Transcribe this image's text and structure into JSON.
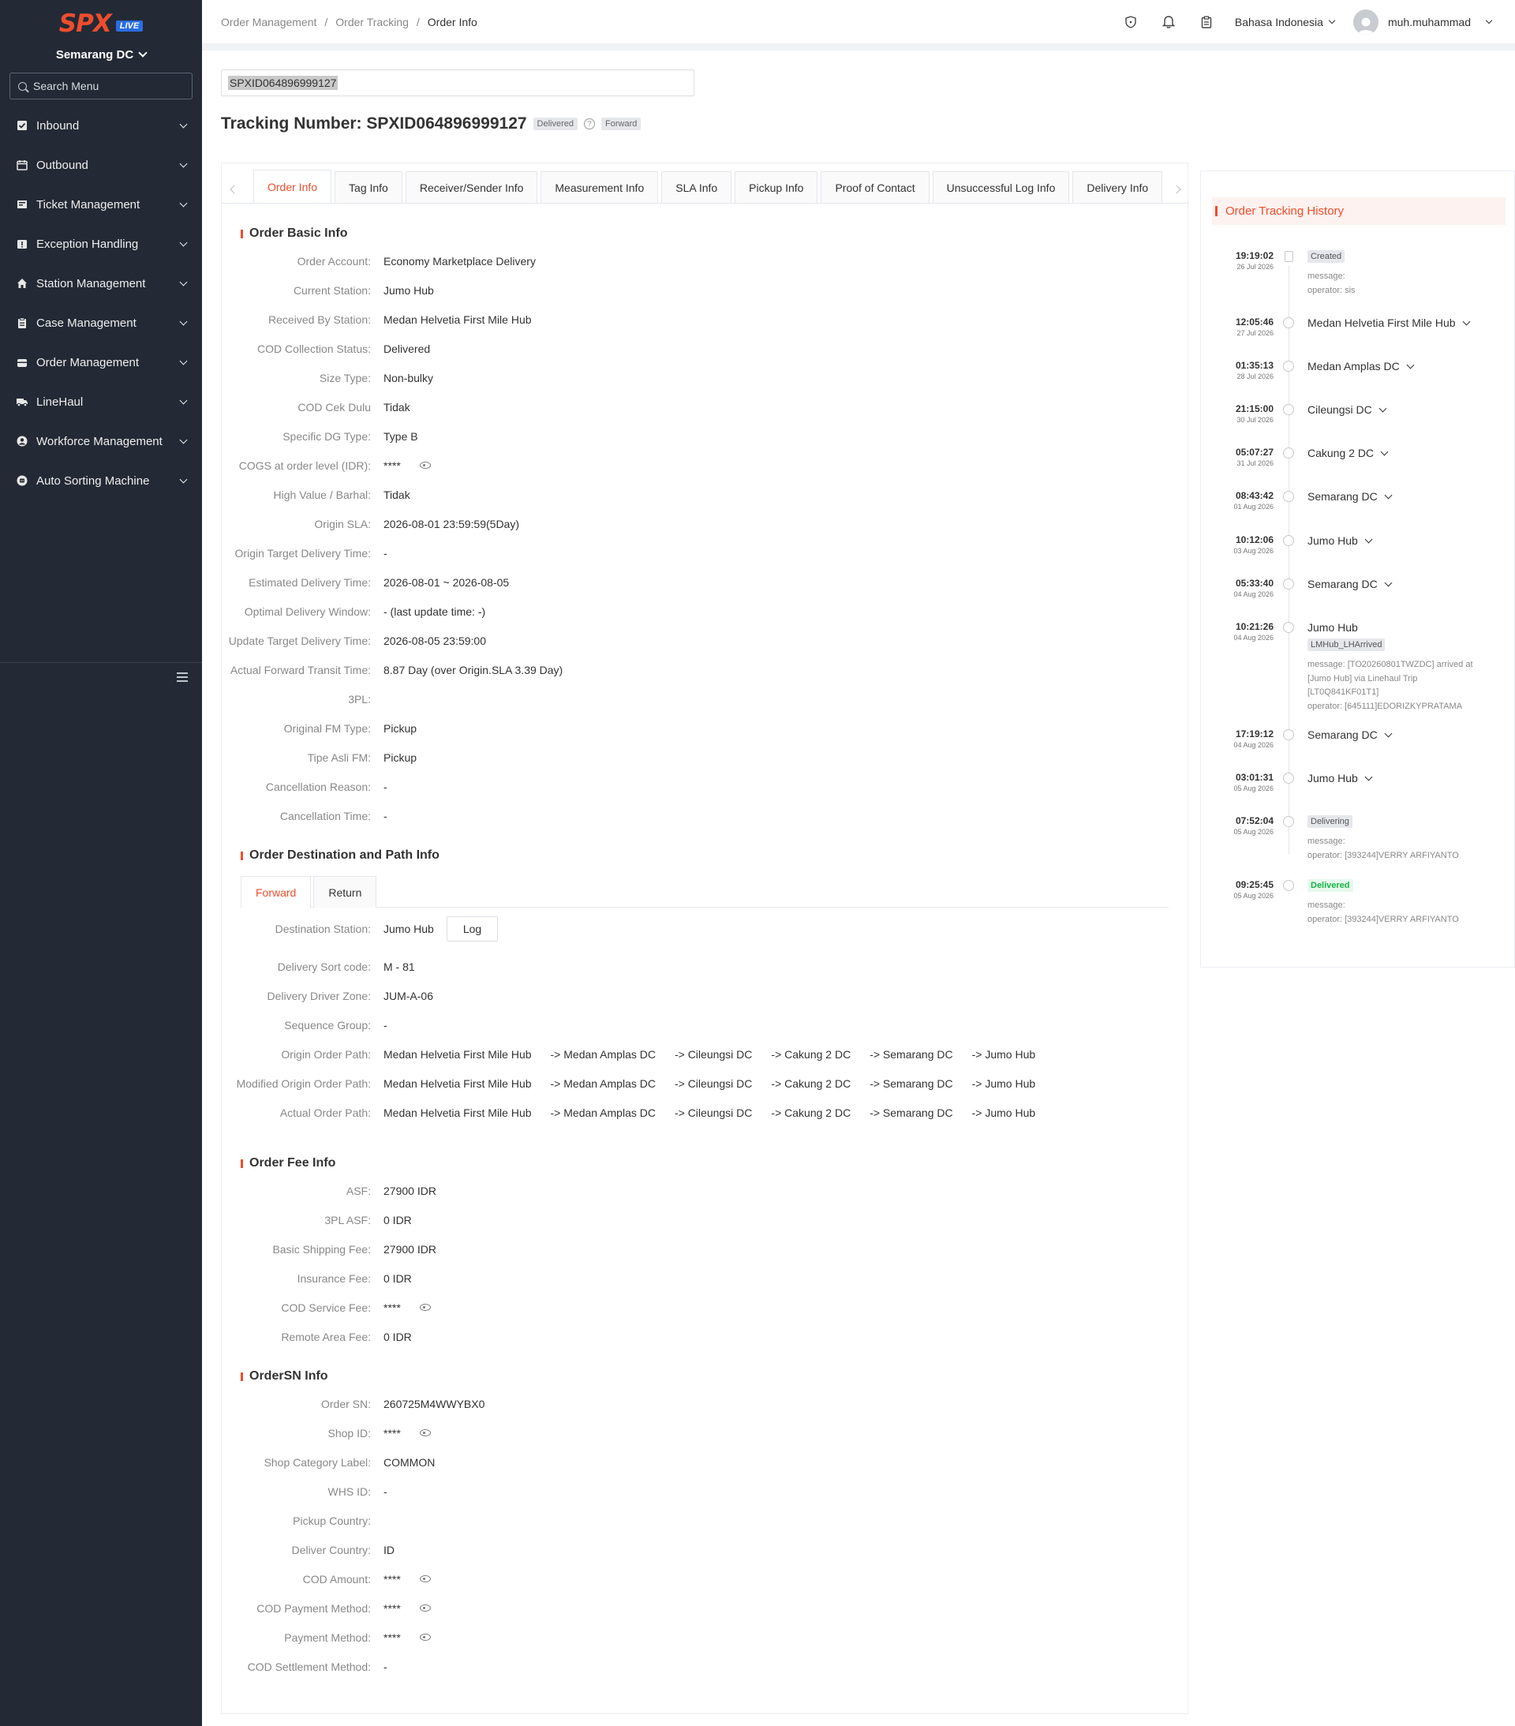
{
  "sidebar": {
    "logo": "SPX",
    "live_badge": "LIVE",
    "station": "Semarang DC",
    "search_placeholder": "Search Menu",
    "items": [
      {
        "label": "Inbound",
        "icon": "inbound-icon"
      },
      {
        "label": "Outbound",
        "icon": "calendar-icon"
      },
      {
        "label": "Ticket Management",
        "icon": "ticket-icon"
      },
      {
        "label": "Exception Handling",
        "icon": "warning-icon"
      },
      {
        "label": "Station Management",
        "icon": "home-icon"
      },
      {
        "label": "Case Management",
        "icon": "clipboard-icon"
      },
      {
        "label": "Order Management",
        "icon": "order-icon"
      },
      {
        "label": "LineHaul",
        "icon": "truck-icon"
      },
      {
        "label": "Workforce Management",
        "icon": "user-circle-icon"
      },
      {
        "label": "Auto Sorting Machine",
        "icon": "robot-icon"
      }
    ]
  },
  "header": {
    "breadcrumb": [
      "Order Management",
      "Order Tracking",
      "Order Info"
    ],
    "language": "Bahasa Indonesia",
    "username": "muh.muhammad"
  },
  "top": {
    "search_value": "SPXID064896999127",
    "title": "Tracking Number: SPXID064896999127",
    "status": "Delivered",
    "direction": "Forward"
  },
  "tabs": [
    "Order Info",
    "Tag Info",
    "Receiver/Sender Info",
    "Measurement Info",
    "SLA Info",
    "Pickup Info",
    "Proof of Contact",
    "Unsuccessful Log Info",
    "Delivery Info"
  ],
  "basic": {
    "title": "Order Basic Info",
    "rows": [
      {
        "label": "Order Account:",
        "value": "Economy Marketplace Delivery"
      },
      {
        "label": "Current Station:",
        "value": "Jumo Hub"
      },
      {
        "label": "Received By Station:",
        "value": "Medan Helvetia First Mile Hub"
      },
      {
        "label": "COD Collection Status:",
        "value": "Delivered"
      },
      {
        "label": "Size Type:",
        "value": "Non-bulky"
      },
      {
        "label": "COD Cek Dulu",
        "value": "Tidak"
      },
      {
        "label": "Specific DG Type:",
        "value": "Type B"
      },
      {
        "label": "COGS at order level (IDR):",
        "value": "****",
        "eye": true
      },
      {
        "label": "High Value / Barhal:",
        "value": "Tidak"
      },
      {
        "label": "Origin SLA:",
        "value": "2026-08-01 23:59:59(5Day)"
      },
      {
        "label": "Origin Target Delivery Time:",
        "value": "-"
      },
      {
        "label": "Estimated Delivery Time:",
        "value": "2026-08-01 ~ 2026-08-05"
      },
      {
        "label": "Optimal Delivery Window:",
        "value": "- (last update time: -)"
      },
      {
        "label": "Update Target Delivery Time:",
        "value": "2026-08-05 23:59:00"
      },
      {
        "label": "Actual Forward Transit Time:",
        "value": "8.87 Day (over Origin.SLA 3.39 Day)"
      },
      {
        "label": "3PL:",
        "value": ""
      },
      {
        "label": "Original FM Type:",
        "value": "Pickup"
      },
      {
        "label": "Tipe Asli FM:",
        "value": "Pickup"
      },
      {
        "label": "Cancellation Reason:",
        "value": "-"
      },
      {
        "label": "Cancellation Time:",
        "value": "-"
      }
    ]
  },
  "dest": {
    "title": "Order Destination and Path Info",
    "sub_tabs": [
      "Forward",
      "Return"
    ],
    "dest_label": "Destination Station:",
    "dest_value": "Jumo Hub",
    "log_button": "Log",
    "rows": [
      {
        "label": "Delivery Sort code:",
        "value": "M - 81"
      },
      {
        "label": "Delivery Driver Zone:",
        "value": "JUM-A-06"
      },
      {
        "label": "Sequence Group:",
        "value": "-"
      }
    ],
    "paths": [
      {
        "label": "Origin Order Path:",
        "nodes": [
          "Medan Helvetia First Mile Hub",
          "-> Medan Amplas DC",
          "-> Cileungsi DC",
          "-> Cakung 2 DC",
          "-> Semarang DC",
          "-> Jumo Hub"
        ]
      },
      {
        "label": "Modified Origin Order Path:",
        "nodes": [
          "Medan Helvetia First Mile Hub",
          "-> Medan Amplas DC",
          "-> Cileungsi DC",
          "-> Cakung 2 DC",
          "-> Semarang DC",
          "-> Jumo Hub"
        ]
      },
      {
        "label": "Actual Order Path:",
        "nodes": [
          "Medan Helvetia First Mile Hub",
          "-> Medan Amplas DC",
          "-> Cileungsi DC",
          "-> Cakung 2 DC",
          "-> Semarang DC",
          "-> Jumo Hub"
        ]
      }
    ]
  },
  "fee": {
    "title": "Order Fee Info",
    "rows": [
      {
        "label": "ASF:",
        "value": "27900 IDR"
      },
      {
        "label": "3PL ASF:",
        "value": "0 IDR"
      },
      {
        "label": "Basic Shipping Fee:",
        "value": "27900 IDR"
      },
      {
        "label": "Insurance Fee:",
        "value": "0 IDR"
      },
      {
        "label": "COD Service Fee:",
        "value": "****",
        "eye": true
      },
      {
        "label": "Remote Area Fee:",
        "value": "0 IDR"
      }
    ]
  },
  "sn": {
    "title": "OrderSN Info",
    "rows": [
      {
        "label": "Order SN:",
        "value": "260725M4WWYBX0"
      },
      {
        "label": "Shop ID:",
        "value": "****",
        "eye": true
      },
      {
        "label": "Shop Category Label:",
        "value": "COMMON"
      },
      {
        "label": "WHS ID:",
        "value": "-"
      },
      {
        "label": "Pickup Country:",
        "value": ""
      },
      {
        "label": "Deliver Country:",
        "value": "ID"
      },
      {
        "label": "COD Amount:",
        "value": "****",
        "eye": true
      },
      {
        "label": "COD Payment Method:",
        "value": "****",
        "eye": true
      },
      {
        "label": "Payment Method:",
        "value": "****",
        "eye": true
      },
      {
        "label": "COD Settlement Method:",
        "value": "-"
      }
    ]
  },
  "history": {
    "title": "Order Tracking History",
    "events": [
      {
        "time": "19:19:02",
        "date": "26 Jul 2026",
        "tag": "Created",
        "msg": [
          "message:",
          "operator: sis"
        ]
      },
      {
        "time": "12:05:46",
        "date": "27 Jul 2026",
        "name": "Medan Helvetia First Mile Hub"
      },
      {
        "time": "01:35:13",
        "date": "28 Jul 2026",
        "name": "Medan Amplas DC"
      },
      {
        "time": "21:15:00",
        "date": "30 Jul 2026",
        "name": "Cileungsi DC"
      },
      {
        "time": "05:07:27",
        "date": "31 Jul 2026",
        "name": "Cakung 2 DC"
      },
      {
        "time": "08:43:42",
        "date": "01 Aug 2026",
        "name": "Semarang DC"
      },
      {
        "time": "10:12:06",
        "date": "03 Aug 2026",
        "name": "Jumo Hub"
      },
      {
        "time": "05:33:40",
        "date": "04 Aug 2026",
        "name": "Semarang DC"
      },
      {
        "time": "10:21:26",
        "date": "04 Aug 2026",
        "name": "Jumo Hub",
        "tag": "LMHub_LHArrived",
        "msg": [
          "message: [TO20260801TWZDC] arrived at",
          "[Jumo Hub] via Linehaul Trip",
          "[LT0Q841KF01T1]",
          "operator: [645111]EDORIZKYPRATAMA"
        ]
      },
      {
        "time": "17:19:12",
        "date": "04 Aug 2026",
        "name": "Semarang DC"
      },
      {
        "time": "03:01:31",
        "date": "05 Aug 2026",
        "name": "Jumo Hub"
      },
      {
        "time": "07:52:04",
        "date": "05 Aug 2026",
        "tag": "Delivering",
        "msg": [
          "message:",
          "operator: [393244]VERRY ARFIYANTO"
        ]
      },
      {
        "time": "09:25:45",
        "date": "05 Aug 2026",
        "tag": "Delivered",
        "tag_color": "green",
        "msg": [
          "message:",
          "operator: [393244]VERRY ARFIYANTO"
        ]
      }
    ]
  },
  "colors": {
    "accent": "#ee4d2d",
    "sidebar_bg": "#232a35",
    "live": "#2b6de0",
    "delivered_green": "#18b54a"
  }
}
